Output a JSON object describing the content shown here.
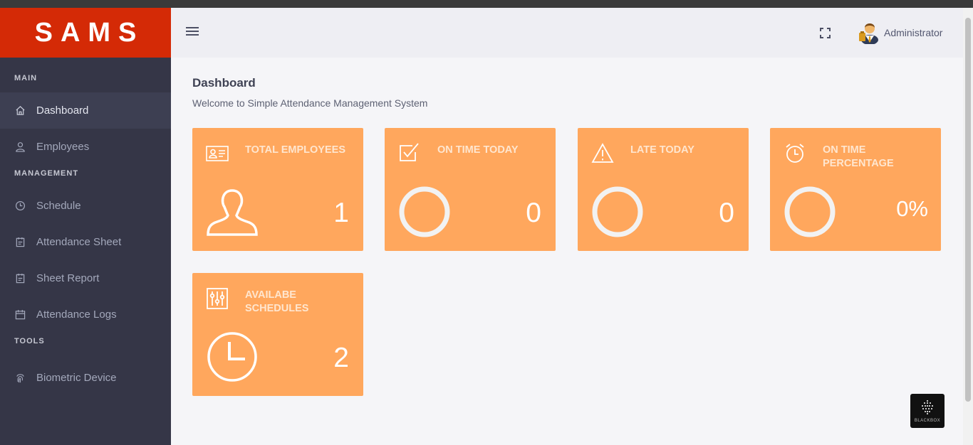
{
  "brand": "SAMS",
  "sidebar": {
    "sections": [
      {
        "title": "MAIN",
        "items": [
          {
            "label": "Dashboard",
            "icon": "home-icon",
            "active": true
          },
          {
            "label": "Employees",
            "icon": "user-icon",
            "active": false
          }
        ]
      },
      {
        "title": "MANAGEMENT",
        "items": [
          {
            "label": "Schedule",
            "icon": "clock-icon",
            "active": false
          },
          {
            "label": "Attendance Sheet",
            "icon": "clipboard-icon",
            "active": false
          },
          {
            "label": "Sheet Report",
            "icon": "clipboard-icon",
            "active": false
          },
          {
            "label": "Attendance Logs",
            "icon": "calendar-icon",
            "active": false
          }
        ]
      },
      {
        "title": "TOOLS",
        "items": [
          {
            "label": "Biometric Device",
            "icon": "fingerprint-icon",
            "active": false
          }
        ]
      }
    ]
  },
  "header": {
    "user_name": "Administrator"
  },
  "page": {
    "title": "Dashboard",
    "subtitle": "Welcome to Simple Attendance Management System"
  },
  "cards": [
    {
      "label": "TOTAL EMPLOYEES",
      "value": "1",
      "icon": "id-card-icon",
      "big_icon": "person-icon"
    },
    {
      "label": "ON TIME TODAY",
      "value": "0",
      "icon": "checkbox-icon",
      "big_icon": "ring-icon"
    },
    {
      "label": "LATE TODAY",
      "value": "0",
      "icon": "warning-icon",
      "big_icon": "ring-icon"
    },
    {
      "label": "ON TIME PERCENTAGE",
      "value": "0%",
      "icon": "alarm-clock-icon",
      "big_icon": "ring-icon"
    },
    {
      "label": "AVAILABE SCHEDULES",
      "value": "2",
      "icon": "sliders-icon",
      "big_icon": "clock-icon"
    }
  ],
  "widget": {
    "label": "BLACKBOX"
  },
  "colors": {
    "brand": "#d42a06",
    "sidebar": "#353647",
    "card": "#ffa75d"
  }
}
